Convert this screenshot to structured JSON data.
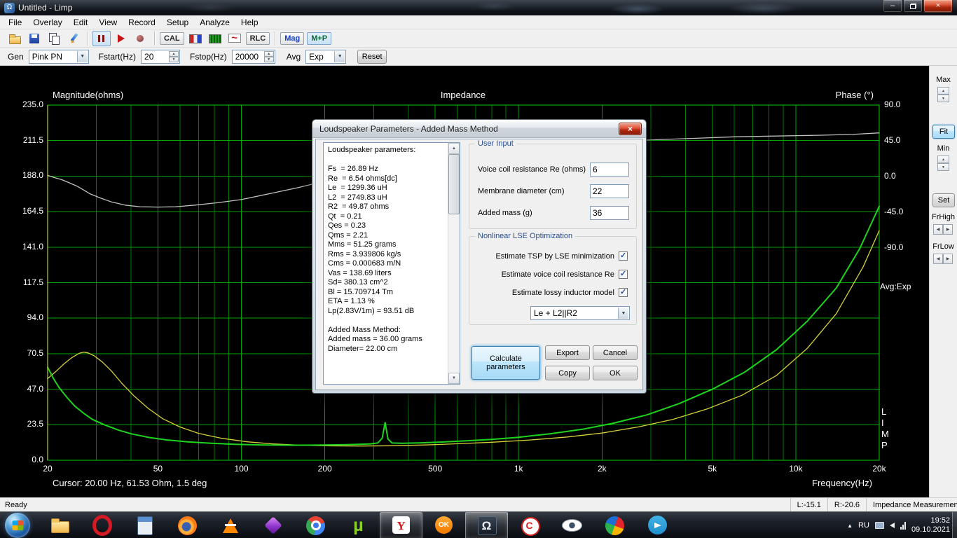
{
  "window": {
    "title": "Untitled - Limp",
    "minimize_glyph": "–",
    "close_glyph": "×"
  },
  "menu": {
    "items": [
      "File",
      "Overlay",
      "Edit",
      "View",
      "Record",
      "Setup",
      "Analyze",
      "Help"
    ]
  },
  "toolbar": {
    "cal": "CAL",
    "rlc": "RLC",
    "mag": "Mag",
    "mp": "M+P"
  },
  "generator_bar": {
    "gen_label": "Gen",
    "gen_value": "Pink PN",
    "fstart_label": "Fstart(Hz)",
    "fstart_value": "20",
    "fstop_label": "Fstop(Hz)",
    "fstop_value": "20000",
    "avg_label": "Avg",
    "avg_value": "Exp",
    "reset": "Reset"
  },
  "chart": {
    "title": "Impedance",
    "left_axis": "Magnitude(ohms)",
    "right_axis": "Phase (°)",
    "x_axis": "Frequency(Hz)",
    "cursor": "Cursor: 20.00 Hz, 61.53 Ohm, 1.5 deg",
    "mag_ticks": [
      "235.0",
      "211.5",
      "188.0",
      "164.5",
      "141.0",
      "117.5",
      "94.0",
      "70.5",
      "47.0",
      "23.5",
      "0.0"
    ],
    "phase_ticks": [
      "90.0",
      "45.0",
      "0.0",
      "-45.0",
      "-90.0"
    ],
    "freq_ticks": [
      "20",
      "50",
      "100",
      "200",
      "500",
      "1k",
      "2k",
      "5k",
      "10k",
      "20k"
    ],
    "freq_tick_values": [
      20,
      50,
      100,
      200,
      500,
      1000,
      2000,
      5000,
      10000,
      20000
    ]
  },
  "chart_data": {
    "type": "line",
    "title": "Impedance",
    "xlabel": "Frequency(Hz)",
    "ylabel_left": "Magnitude(ohms)",
    "ylabel_right": "Phase (°)",
    "x_scale": "log",
    "xlim": [
      20,
      20000
    ],
    "ylim_magnitude": [
      0,
      235
    ],
    "ylim_phase": [
      -90,
      90
    ],
    "grid": true,
    "legend": "none",
    "cursor": {
      "freq_hz": 20.0,
      "magnitude_ohm": 61.53,
      "phase_deg": 1.5
    },
    "series": [
      {
        "name": "phase",
        "axis": "phase",
        "color": "#c0c0c0",
        "x": [
          20,
          21,
          22.5,
          24,
          25.5,
          27,
          28.5,
          31,
          34,
          38,
          43,
          50,
          58,
          68,
          82,
          100,
          125,
          160,
          210,
          280,
          380,
          520,
          720,
          1000,
          1400,
          2000,
          2900,
          4200,
          6000,
          8500,
          12000,
          16000,
          20000
        ],
        "y": [
          1.5,
          -1,
          -4,
          -8,
          -12,
          -17,
          -22,
          -27,
          -32,
          -36,
          -38,
          -38.5,
          -38,
          -36,
          -33,
          -29,
          -22,
          -14,
          -4,
          6,
          16,
          25,
          32,
          37,
          41,
          44,
          46,
          48,
          50,
          51,
          52,
          53,
          55
        ]
      },
      {
        "name": "impedance-overlay-free-air",
        "axis": "magnitude",
        "color": "#d4cf3a",
        "x": [
          20,
          21.5,
          23,
          24.5,
          26,
          27,
          28,
          29.5,
          31.5,
          34,
          37,
          41,
          46,
          52,
          60,
          70,
          85,
          105,
          130,
          165,
          210,
          270,
          350,
          460,
          600,
          800,
          1100,
          1500,
          2000,
          2700,
          3600,
          4800,
          6400,
          8500,
          11000,
          14000,
          17500,
          20000
        ],
        "y": [
          54,
          59,
          64,
          68,
          70.8,
          71.5,
          71,
          69,
          65,
          59,
          51,
          42.5,
          34.5,
          27.5,
          22,
          17.8,
          14.5,
          12.2,
          10.8,
          9.9,
          9.5,
          9.4,
          9.6,
          10.1,
          10.9,
          11.9,
          13.4,
          15.4,
          18,
          22,
          27,
          34,
          43,
          56,
          74,
          97,
          128,
          152
        ]
      },
      {
        "name": "impedance-added-mass",
        "axis": "magnitude",
        "color": "#1ed41e",
        "x": [
          20,
          21,
          22,
          23.5,
          25,
          27,
          29,
          32,
          36,
          40,
          46,
          54,
          64,
          78,
          95,
          120,
          150,
          190,
          240,
          290,
          310,
          322,
          330,
          338,
          350,
          380,
          440,
          520,
          640,
          800,
          1000,
          1300,
          1700,
          2200,
          2900,
          3800,
          5000,
          6500,
          8500,
          11000,
          14000,
          17000,
          20000
        ],
        "y": [
          61.5,
          54,
          48,
          41.5,
          36,
          31,
          27,
          23.5,
          20,
          17.5,
          15.2,
          13.4,
          12.2,
          11.2,
          10.5,
          10.1,
          9.9,
          10.0,
          10.3,
          10.8,
          11.4,
          14.5,
          25,
          14,
          11.4,
          11.2,
          11.5,
          12,
          12.8,
          13.8,
          15.2,
          17.5,
          20.5,
          24.5,
          30,
          37.5,
          47,
          58,
          73,
          92,
          114,
          140,
          168
        ]
      }
    ]
  },
  "right_panel": {
    "max": "Max",
    "fit": "Fit",
    "min": "Min",
    "set": "Set",
    "frhigh": "FrHigh",
    "frlow": "FrLow",
    "avg_display": "Avg:Exp",
    "limp": [
      "L",
      "I",
      "M",
      "P"
    ]
  },
  "dialog": {
    "title": "Loudspeaker Parameters - Added Mass Method",
    "close_glyph": "×",
    "params_text": "Loudspeaker parameters:\n\nFs  = 26.89 Hz\nRe  = 6.54 ohms[dc]\nLe  = 1299.36 uH\nL2  = 2749.83 uH\nR2  = 49.87 ohms\nQt  = 0.21\nQes = 0.23\nQms = 2.21\nMms = 51.25 grams\nRms = 3.939806 kg/s\nCms = 0.000683 m/N\nVas = 138.69 liters\nSd= 380.13 cm^2\nBl = 15.709714 Tm\nETA = 1.13 %\nLp(2.83V/1m) = 93.51 dB\n\nAdded Mass Method:\nAdded mass = 36.00 grams\nDiameter= 22.00 cm",
    "user_input": {
      "title": "User Input",
      "fields": [
        {
          "label": "Voice coil resistance Re (ohms)",
          "value": "6"
        },
        {
          "label": "Membrane diameter (cm)",
          "value": "22"
        },
        {
          "label": "Added mass (g)",
          "value": "36"
        }
      ]
    },
    "lse": {
      "title": "Nonlinear LSE Optimization",
      "checkboxes": [
        {
          "label": "Estimate TSP by LSE minimization",
          "checked": true
        },
        {
          "label": "Estimate voice coil resistance Re",
          "checked": true
        },
        {
          "label": "Estimate lossy inductor model",
          "checked": true
        }
      ],
      "inductor_model": "Le + L2||R2"
    },
    "buttons": {
      "calculate": "Calculate parameters",
      "export": "Export",
      "cancel": "Cancel",
      "copy": "Copy",
      "ok": "OK"
    }
  },
  "status": {
    "ready": "Ready",
    "left_level": "L:-15.1",
    "right_level": "R:-20.6",
    "mode": "Impedance Measuremen"
  },
  "taskbar": {
    "icons": [
      {
        "name": "windows-explorer",
        "glyph": ""
      },
      {
        "name": "opera",
        "glyph": ""
      },
      {
        "name": "calculator",
        "glyph": ""
      },
      {
        "name": "firefox",
        "glyph": ""
      },
      {
        "name": "vlc",
        "glyph": ""
      },
      {
        "name": "purple-app",
        "glyph": ""
      },
      {
        "name": "chrome",
        "glyph": ""
      },
      {
        "name": "utorrent",
        "glyph": "µ"
      },
      {
        "name": "yandex-browser",
        "glyph": "Y",
        "active": true
      },
      {
        "name": "ok-ru",
        "glyph": "OK"
      },
      {
        "name": "limp-omega",
        "glyph": "Ω",
        "active": true
      },
      {
        "name": "red-app",
        "glyph": "C"
      },
      {
        "name": "eye-app",
        "glyph": ""
      },
      {
        "name": "colorful-app",
        "glyph": ""
      },
      {
        "name": "telegram",
        "glyph": ""
      }
    ],
    "tray": {
      "expand": "▲",
      "lang": "RU",
      "time": "19:52",
      "date": "09.10.2021"
    }
  }
}
